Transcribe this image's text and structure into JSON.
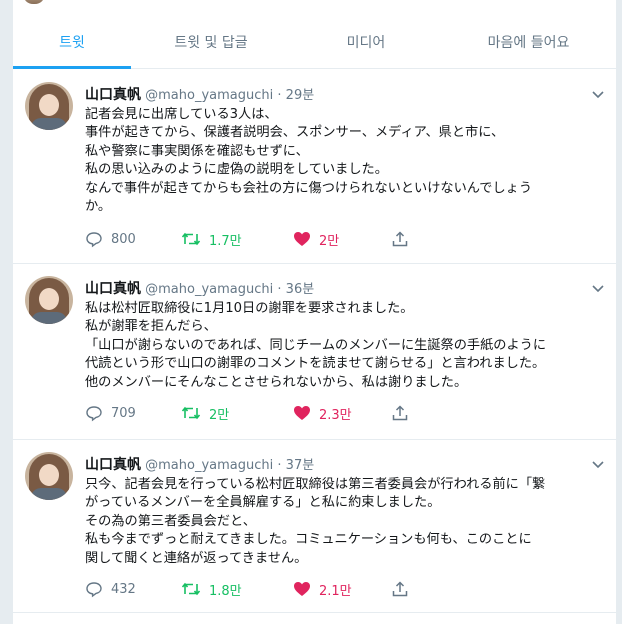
{
  "tabs": [
    {
      "label": "트윗",
      "active": true
    },
    {
      "label": "트윗 및 답글",
      "active": false
    },
    {
      "label": "미디어",
      "active": false
    },
    {
      "label": "마음에 들어요",
      "active": false
    }
  ],
  "colors": {
    "accent": "#1da1f2",
    "retweet": "#17bf63",
    "like": "#e0245e",
    "muted": "#657786"
  },
  "tweets": [
    {
      "name": "山口真帆",
      "handle": "@maho_yamaguchi",
      "time": "29분",
      "lines": [
        "記者会見に出席している3人は、",
        "事件が起きてから、保護者説明会、スポンサー、メディア、県と市に、",
        "私や警察に事実関係を確認もせずに、",
        "私の思い込みのように虚偽の説明をしていました。",
        "なんで事件が起きてからも会社の方に傷つけられないといけないんでしょう",
        "か。"
      ],
      "replies": "800",
      "retweets": "1.7만",
      "likes": "2만"
    },
    {
      "name": "山口真帆",
      "handle": "@maho_yamaguchi",
      "time": "36분",
      "lines": [
        "私は松村匠取締役に1月10日の謝罪を要求されました。",
        "私が謝罪を拒んだら、",
        "「山口が謝らないのであれば、同じチームのメンバーに生誕祭の手紙のように",
        "代読という形で山口の謝罪のコメントを読ませて謝らせる」と言われました。",
        "他のメンバーにそんなことさせられないから、私は謝りました。"
      ],
      "replies": "709",
      "retweets": "2만",
      "likes": "2.3만"
    },
    {
      "name": "山口真帆",
      "handle": "@maho_yamaguchi",
      "time": "37분",
      "lines": [
        "只今、記者会見を行っている松村匠取締役は第三者委員会が行われる前に「繋",
        "がっているメンバーを全員解雇する」と私に約束しました。",
        "その為の第三者委員会だと、",
        "私も今までずっと耐えてきました。コミュニケーションも何も、このことに",
        "関して聞くと連絡が返ってきません。"
      ],
      "replies": "432",
      "retweets": "1.8만",
      "likes": "2.1만"
    }
  ]
}
